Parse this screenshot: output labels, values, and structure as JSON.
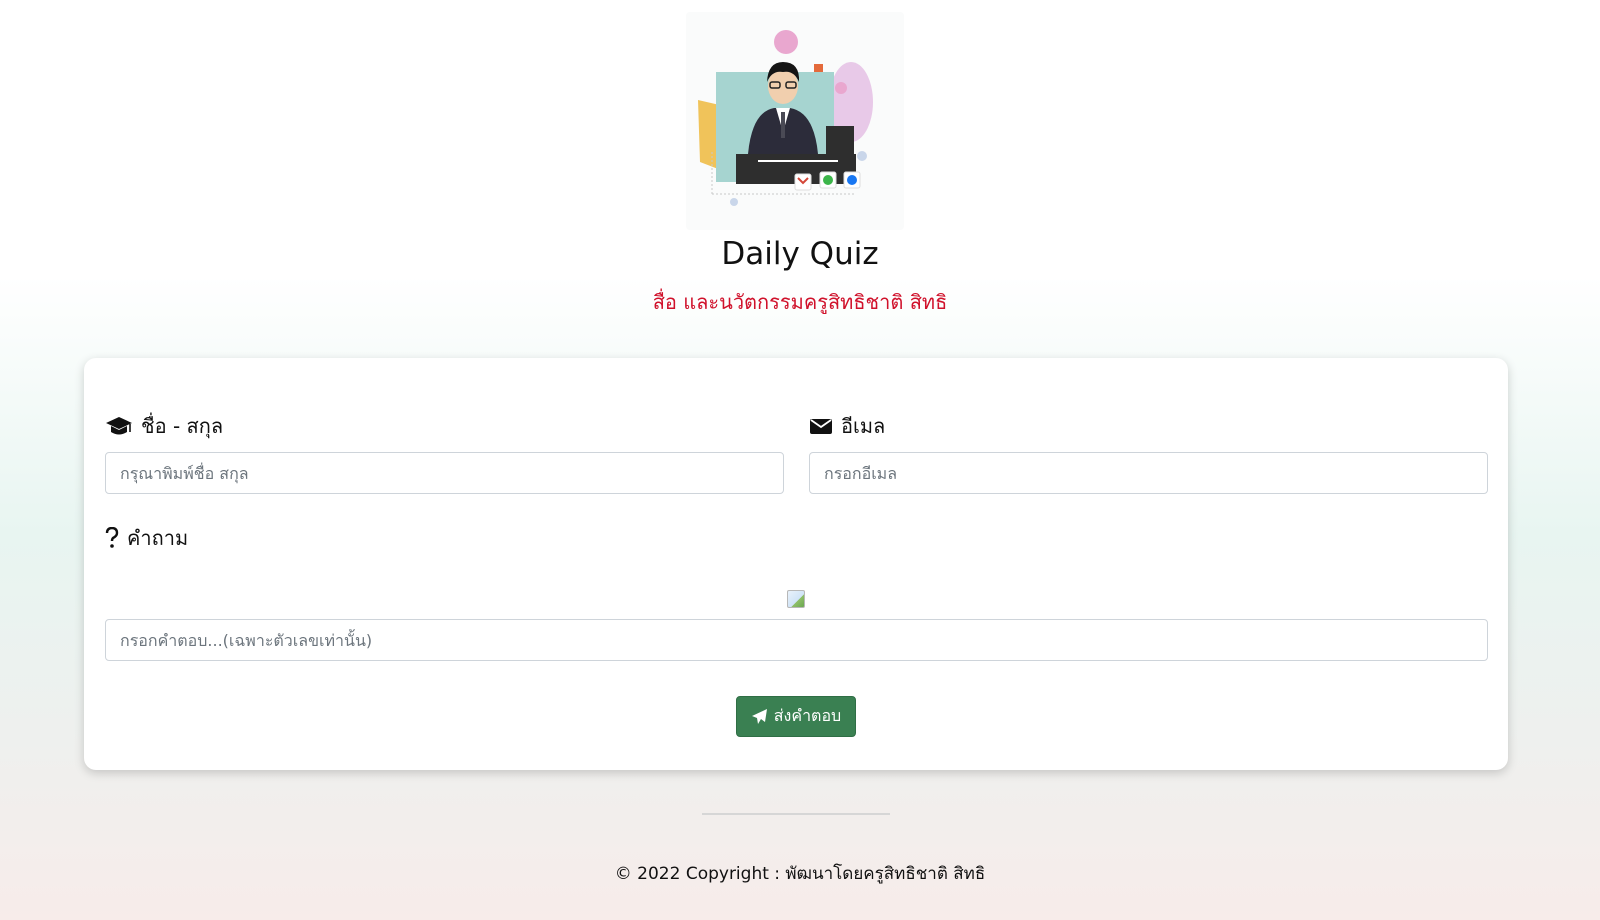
{
  "header": {
    "title": "Daily Quiz",
    "subtitle": "สื่อ และนวัตกรรมครูสิทธิชาติ สิทธิ"
  },
  "form": {
    "name": {
      "label": "ชื่อ - สกุล",
      "placeholder": "กรุณาพิมพ์ชื่อ สกุล",
      "icon": "graduation-cap-icon"
    },
    "email": {
      "label": "อีเมล",
      "placeholder": "กรอกอีเมล",
      "icon": "envelope-icon"
    },
    "question": {
      "label": "คำถาม",
      "icon": "question-icon"
    },
    "answer": {
      "placeholder": "กรอกคำตอบ...(เฉพาะตัวเลขเท่านั้น)"
    },
    "submit": {
      "label": "ส่งคำตอบ",
      "icon": "paper-plane-icon"
    }
  },
  "footer": {
    "copyright": "© 2022 Copyright : พัฒนาโดยครูสิทธิชาติ สิทธิ"
  },
  "colors": {
    "subtitle": "#d0112b",
    "submit_button": "#3a8052"
  }
}
